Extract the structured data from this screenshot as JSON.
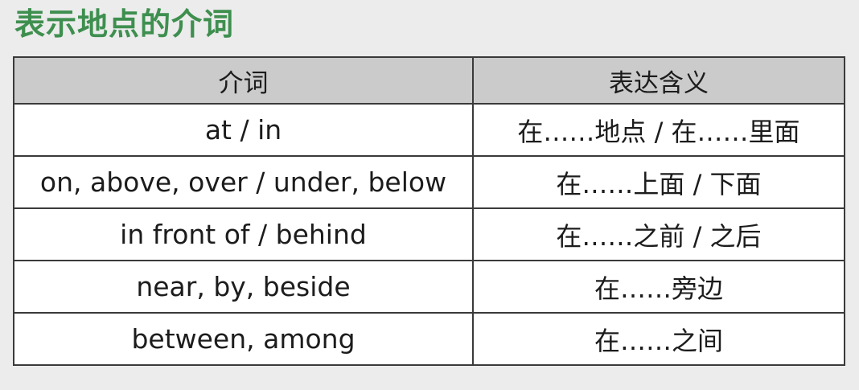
{
  "title": "表示地点的介词",
  "table": {
    "headers": [
      "介词",
      "表达含义"
    ],
    "rows": [
      {
        "preposition": "at / in",
        "meaning": "在……地点 / 在……里面"
      },
      {
        "preposition": "on, above, over / under, below",
        "meaning": "在……上面 / 下面"
      },
      {
        "preposition": "in front of / behind",
        "meaning": "在……之前 / 之后"
      },
      {
        "preposition": "near, by, beside",
        "meaning": "在……旁边"
      },
      {
        "preposition": "between, among",
        "meaning": "在……之间"
      }
    ]
  }
}
